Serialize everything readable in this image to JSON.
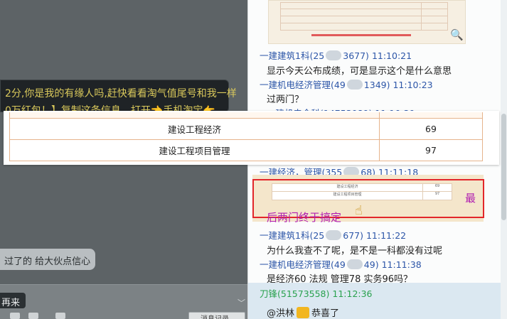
{
  "left_panel": {
    "dark_bubble_line1": "2分,你是我的有缘人吗,赶快看看淘气值尾号和我一样",
    "dark_bubble_line2": "0万红包！】复制这条信息，打开👈手机淘宝👉",
    "light_bubble": "过了的  给大伙点信心",
    "again_tag": "再来",
    "chevron": "﹀",
    "message_record": "消息记录"
  },
  "right_panel": {
    "messages": [
      {
        "sender_prefix": "一建建筑1科(25",
        "sender_suffix": "3677)",
        "time": "11:10:21",
        "text": "显示今天公布成绩，可是显示这个是什么意思"
      },
      {
        "sender_prefix": "一建机电经济管理(49",
        "sender_suffix": "1349)",
        "time": "11:10:23",
        "text": "过两门？"
      },
      {
        "sender_prefix": "一建机电全科(14753089)",
        "sender_suffix": "",
        "time": "11:10:39",
        "text": ""
      },
      {
        "sender_prefix": "一建经济，管理(355",
        "sender_suffix": "68)",
        "time": "11:11:18",
        "text": ""
      },
      {
        "sender_prefix": "一建建筑1科(25",
        "sender_suffix": "677)",
        "time": "11:11:22",
        "text": "为什么我查不了呢，是不是一科都没有过呢"
      },
      {
        "sender_prefix": "一建机电经济管理(49",
        "sender_suffix": "49)",
        "time": "11:11:38",
        "text": "是经济60  法规 管理78  实务96吗？"
      },
      {
        "sender_prefix": "刀锋(51573558)",
        "sender_suffix": "",
        "time": "11:12:36",
        "text_prefix": "@洪林",
        "text_suffix": "恭喜了"
      }
    ],
    "highlight_side_text": "最",
    "highlight_caption": "后两门终于搞定",
    "mini_table": [
      {
        "subject": "建设工程经济",
        "score": "69"
      },
      {
        "subject": "建设工程项目管理",
        "score": "97"
      }
    ]
  },
  "overlay_table": {
    "rows": [
      {
        "subject": "建设工程经济",
        "score": "69"
      },
      {
        "subject": "建设工程项目管理",
        "score": "97"
      }
    ]
  },
  "colors": {
    "sender_blue": "#2d56a8",
    "sender_green": "#29a14e",
    "highlight_red": "#e2262a",
    "caption_magenta": "#b01eb0",
    "table_border": "#e6b48c"
  }
}
